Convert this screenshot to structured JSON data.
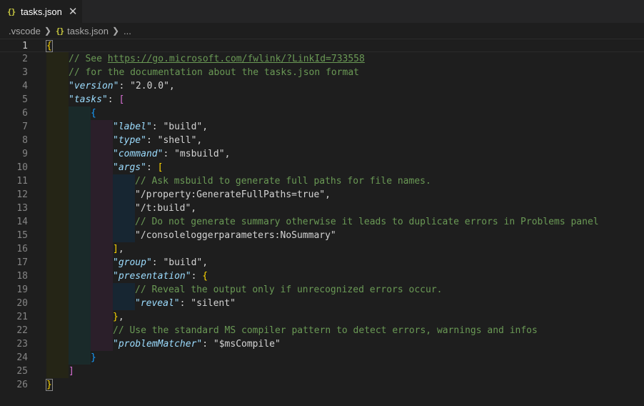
{
  "tab": {
    "icon": "{}",
    "title": "tasks.json",
    "close_glyph": "✕"
  },
  "breadcrumb": {
    "folder": ".vscode",
    "file_icon": "{}",
    "file": "tasks.json",
    "more": "..."
  },
  "editor": {
    "active_line": 1,
    "lines": [
      {
        "n": "1",
        "indent": 0,
        "tokens": [
          {
            "t": "{",
            "c": "t-b1 cursor-box"
          }
        ]
      },
      {
        "n": "2",
        "indent": 1,
        "tokens": [
          {
            "t": "// See ",
            "c": "t-com"
          },
          {
            "t": "https://go.microsoft.com/fwlink/?LinkId=733558",
            "c": "t-link"
          }
        ]
      },
      {
        "n": "3",
        "indent": 1,
        "tokens": [
          {
            "t": "// for the documentation about the tasks.json format",
            "c": "t-com"
          }
        ]
      },
      {
        "n": "4",
        "indent": 1,
        "tokens": [
          {
            "t": "\"version\"",
            "c": "t-key"
          },
          {
            "t": ": ",
            "c": "t-p"
          },
          {
            "t": "\"2.0.0\"",
            "c": "t-strw"
          },
          {
            "t": ",",
            "c": "t-p"
          }
        ]
      },
      {
        "n": "5",
        "indent": 1,
        "tokens": [
          {
            "t": "\"tasks\"",
            "c": "t-key"
          },
          {
            "t": ": ",
            "c": "t-p"
          },
          {
            "t": "[",
            "c": "t-b2"
          }
        ]
      },
      {
        "n": "6",
        "indent": 2,
        "tokens": [
          {
            "t": "{",
            "c": "t-b3"
          }
        ]
      },
      {
        "n": "7",
        "indent": 3,
        "tokens": [
          {
            "t": "\"label\"",
            "c": "t-key"
          },
          {
            "t": ": ",
            "c": "t-p"
          },
          {
            "t": "\"build\"",
            "c": "t-strw"
          },
          {
            "t": ",",
            "c": "t-p"
          }
        ]
      },
      {
        "n": "8",
        "indent": 3,
        "tokens": [
          {
            "t": "\"type\"",
            "c": "t-key"
          },
          {
            "t": ": ",
            "c": "t-p"
          },
          {
            "t": "\"shell\"",
            "c": "t-strw"
          },
          {
            "t": ",",
            "c": "t-p"
          }
        ]
      },
      {
        "n": "9",
        "indent": 3,
        "tokens": [
          {
            "t": "\"command\"",
            "c": "t-key"
          },
          {
            "t": ": ",
            "c": "t-p"
          },
          {
            "t": "\"msbuild\"",
            "c": "t-strw"
          },
          {
            "t": ",",
            "c": "t-p"
          }
        ]
      },
      {
        "n": "10",
        "indent": 3,
        "tokens": [
          {
            "t": "\"args\"",
            "c": "t-key"
          },
          {
            "t": ": ",
            "c": "t-p"
          },
          {
            "t": "[",
            "c": "t-b1"
          }
        ]
      },
      {
        "n": "11",
        "indent": 4,
        "tokens": [
          {
            "t": "// Ask msbuild to generate full paths for file names.",
            "c": "t-com"
          }
        ]
      },
      {
        "n": "12",
        "indent": 4,
        "tokens": [
          {
            "t": "\"/property:GenerateFullPaths=true\"",
            "c": "t-strw"
          },
          {
            "t": ",",
            "c": "t-p"
          }
        ]
      },
      {
        "n": "13",
        "indent": 4,
        "tokens": [
          {
            "t": "\"/t:build\"",
            "c": "t-strw"
          },
          {
            "t": ",",
            "c": "t-p"
          }
        ]
      },
      {
        "n": "14",
        "indent": 4,
        "tokens": [
          {
            "t": "// Do not generate summary otherwise it leads to duplicate errors in Problems panel",
            "c": "t-com"
          }
        ]
      },
      {
        "n": "15",
        "indent": 4,
        "tokens": [
          {
            "t": "\"/consoleloggerparameters:NoSummary\"",
            "c": "t-strw"
          }
        ]
      },
      {
        "n": "16",
        "indent": 3,
        "tokens": [
          {
            "t": "]",
            "c": "t-b1"
          },
          {
            "t": ",",
            "c": "t-p"
          }
        ]
      },
      {
        "n": "17",
        "indent": 3,
        "tokens": [
          {
            "t": "\"group\"",
            "c": "t-key"
          },
          {
            "t": ": ",
            "c": "t-p"
          },
          {
            "t": "\"build\"",
            "c": "t-strw"
          },
          {
            "t": ",",
            "c": "t-p"
          }
        ]
      },
      {
        "n": "18",
        "indent": 3,
        "tokens": [
          {
            "t": "\"presentation\"",
            "c": "t-key"
          },
          {
            "t": ": ",
            "c": "t-p"
          },
          {
            "t": "{",
            "c": "t-b1"
          }
        ]
      },
      {
        "n": "19",
        "indent": 4,
        "tokens": [
          {
            "t": "// Reveal the output only if unrecognized errors occur.",
            "c": "t-com"
          }
        ]
      },
      {
        "n": "20",
        "indent": 4,
        "tokens": [
          {
            "t": "\"reveal\"",
            "c": "t-key"
          },
          {
            "t": ": ",
            "c": "t-p"
          },
          {
            "t": "\"silent\"",
            "c": "t-strw"
          }
        ]
      },
      {
        "n": "21",
        "indent": 3,
        "tokens": [
          {
            "t": "}",
            "c": "t-b1"
          },
          {
            "t": ",",
            "c": "t-p"
          }
        ]
      },
      {
        "n": "22",
        "indent": 3,
        "tokens": [
          {
            "t": "// Use the standard MS compiler pattern to detect errors, warnings and infos",
            "c": "t-com"
          }
        ]
      },
      {
        "n": "23",
        "indent": 3,
        "tokens": [
          {
            "t": "\"problemMatcher\"",
            "c": "t-key"
          },
          {
            "t": ": ",
            "c": "t-p"
          },
          {
            "t": "\"$msCompile\"",
            "c": "t-strw"
          }
        ]
      },
      {
        "n": "24",
        "indent": 2,
        "tokens": [
          {
            "t": "}",
            "c": "t-b3"
          }
        ]
      },
      {
        "n": "25",
        "indent": 1,
        "tokens": [
          {
            "t": "]",
            "c": "t-b2"
          }
        ]
      },
      {
        "n": "26",
        "indent": 0,
        "tokens": [
          {
            "t": "}",
            "c": "t-b1 cursor-box"
          }
        ]
      }
    ]
  }
}
